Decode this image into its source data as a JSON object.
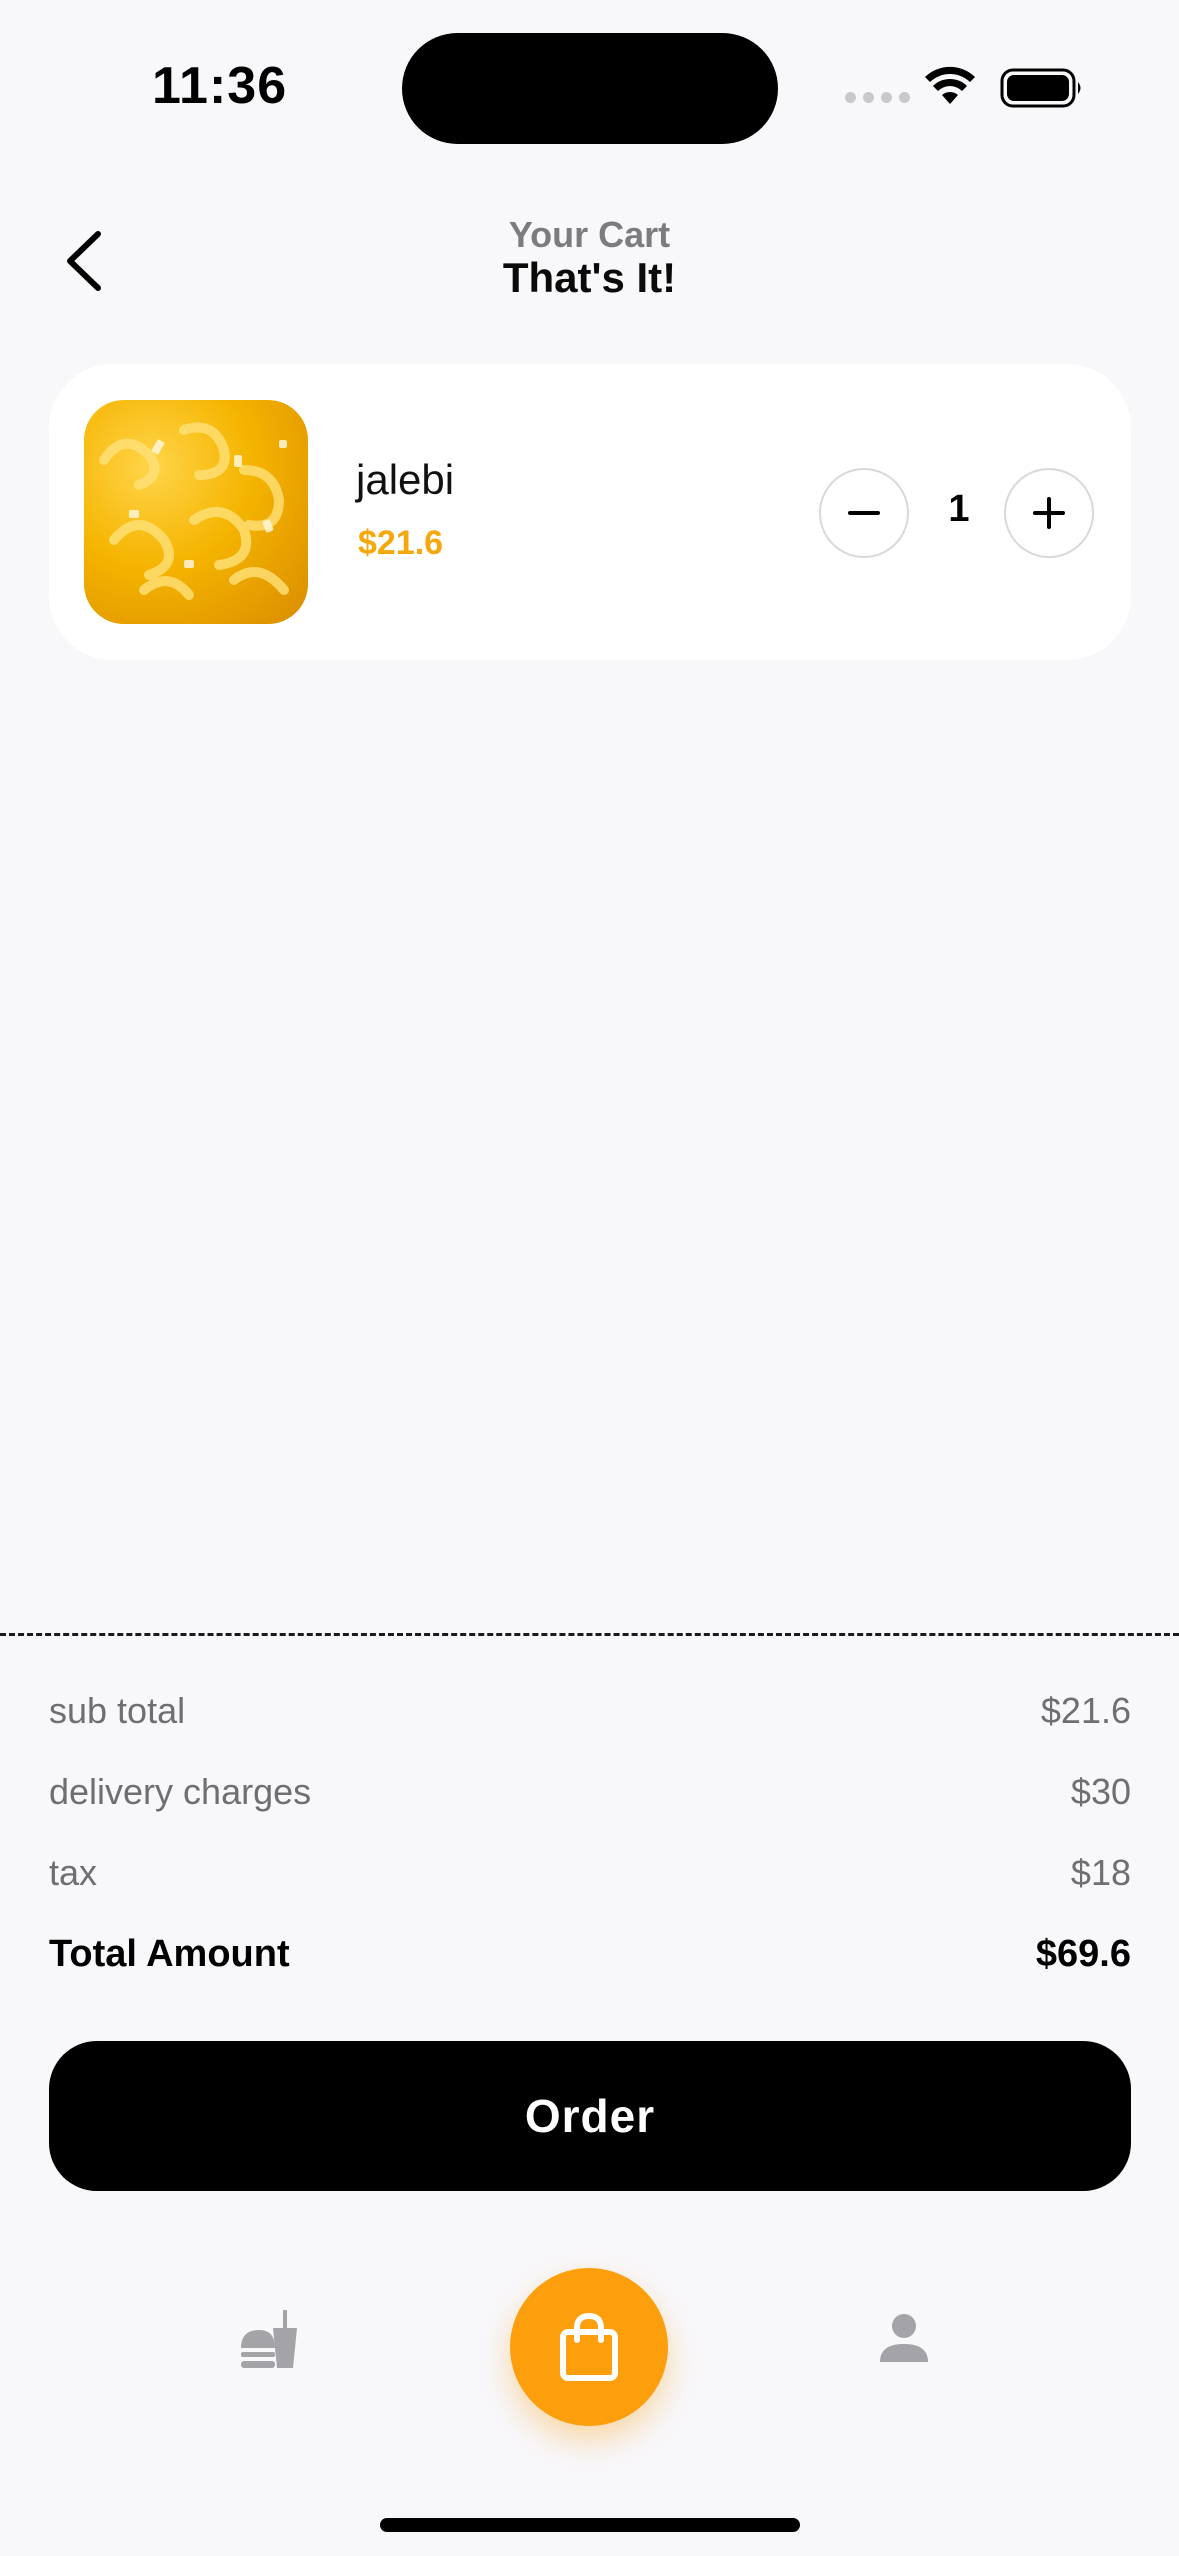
{
  "status_bar": {
    "time": "11:36"
  },
  "header": {
    "subtitle": "Your Cart",
    "title": "That's It!"
  },
  "cart": {
    "items": [
      {
        "name": "jalebi",
        "price": "$21.6",
        "quantity": "1"
      }
    ]
  },
  "summary": {
    "subtotal_label": "sub total",
    "subtotal_value": "$21.6",
    "delivery_label": "delivery charges",
    "delivery_value": "$30",
    "tax_label": "tax",
    "tax_value": "$18",
    "total_label": "Total Amount",
    "total_value": "$69.6"
  },
  "order_button": {
    "label": "Order"
  },
  "colors": {
    "accent": "#fd9e0c",
    "price": "#f6a70b",
    "background": "#f8f7fa"
  },
  "icons": {
    "back": "chevron-left-icon",
    "nav_food": "fastfood-icon",
    "nav_cart": "shopping-bag-icon",
    "nav_profile": "person-icon"
  }
}
